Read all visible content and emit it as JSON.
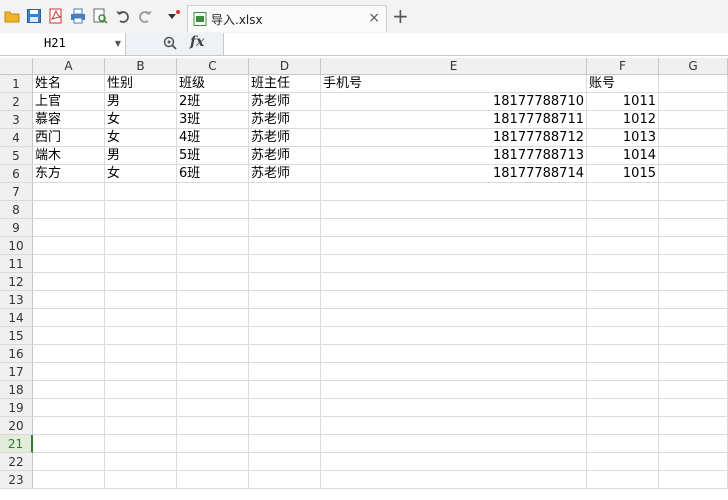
{
  "tab": {
    "title": "导入.xlsx",
    "close": "×",
    "new_tab": "+"
  },
  "formula_bar": {
    "name_box": "H21",
    "fx": "fx",
    "formula": ""
  },
  "columns": [
    "A",
    "B",
    "C",
    "D",
    "E",
    "F",
    "G"
  ],
  "rows": [
    "1",
    "2",
    "3",
    "4",
    "5",
    "6",
    "7",
    "8",
    "9",
    "10",
    "11",
    "12",
    "13",
    "14",
    "15",
    "16",
    "17",
    "18",
    "19",
    "20",
    "21",
    "22",
    "23"
  ],
  "active_row": "21",
  "cells": [
    [
      "姓名",
      "性别",
      "班级",
      "班主任",
      "手机号",
      "账号"
    ],
    [
      "上官",
      "男",
      "2班",
      "苏老师",
      "18177788710",
      "1011"
    ],
    [
      "慕容",
      "女",
      "3班",
      "苏老师",
      "18177788711",
      "1012"
    ],
    [
      "西门",
      "女",
      "4班",
      "苏老师",
      "18177788712",
      "1013"
    ],
    [
      "端木",
      "男",
      "5班",
      "苏老师",
      "18177788713",
      "1014"
    ],
    [
      "东方",
      "女",
      "6班",
      "苏老师",
      "18177788714",
      "1015"
    ]
  ],
  "icons": [
    "open-folder-icon",
    "save-icon",
    "export-pdf-icon",
    "print-icon",
    "print-preview-icon",
    "undo-icon",
    "redo-icon",
    "customize-dropdown-icon",
    "spreadsheet-file-icon",
    "zoom-icon"
  ]
}
